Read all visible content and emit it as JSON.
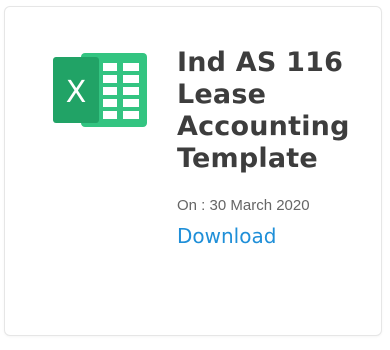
{
  "card": {
    "icon": "excel-file-icon",
    "icon_letter": "X",
    "title_lines": [
      "Ind AS 116",
      "Lease",
      "Accounting",
      "Template"
    ],
    "date_prefix": "On : ",
    "date_value": "30 March 2020",
    "download_label": "Download"
  },
  "colors": {
    "excel_green_dark": "#21a366",
    "excel_green": "#33c481",
    "excel_green_light": "#8fdbb2",
    "link": "#1f8fd8",
    "title": "#3d3d3d"
  }
}
